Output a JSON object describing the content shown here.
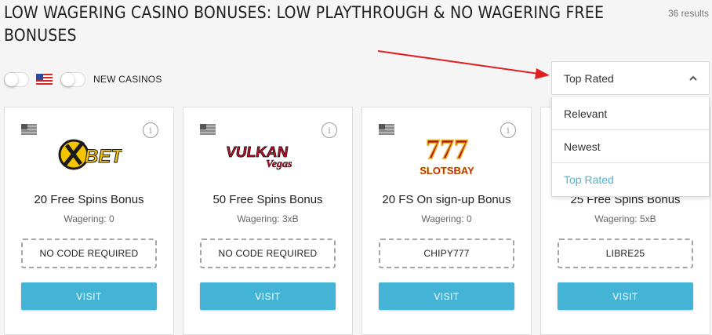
{
  "header": {
    "title": "LOW WAGERING CASINO BONUSES: LOW PLAYTHROUGH & NO WAGERING FREE BONUSES",
    "results": "36 results"
  },
  "filters": {
    "new_casinos_label": "NEW CASINOS"
  },
  "sort": {
    "selected": "Top Rated",
    "options": [
      {
        "label": "Relevant",
        "active": false
      },
      {
        "label": "Newest",
        "active": false
      },
      {
        "label": "Top Rated",
        "active": true
      }
    ]
  },
  "cards": [
    {
      "logo_icon": "xbet-logo",
      "bonus": "20 Free Spins Bonus",
      "wagering": "Wagering: 0",
      "code": "NO CODE REQUIRED",
      "visit": "VISIT"
    },
    {
      "logo_icon": "vulkan-vegas-logo",
      "bonus": "50 Free Spins Bonus",
      "wagering": "Wagering: 3xB",
      "code": "NO CODE REQUIRED",
      "visit": "VISIT"
    },
    {
      "logo_icon": "slotsbay-logo",
      "bonus": "20 FS On sign-up Bonus",
      "wagering": "Wagering: 0",
      "code": "CHIPY777",
      "visit": "VISIT"
    },
    {
      "logo_icon": "casino-logo",
      "bonus": "25 Free Spins Bonus",
      "wagering": "Wagering: 5xB",
      "code": "LIBRE25",
      "visit": "VISIT"
    }
  ],
  "colors": {
    "accent": "#44b4d6",
    "active_option": "#4bb4cf",
    "arrow": "#e02020"
  }
}
